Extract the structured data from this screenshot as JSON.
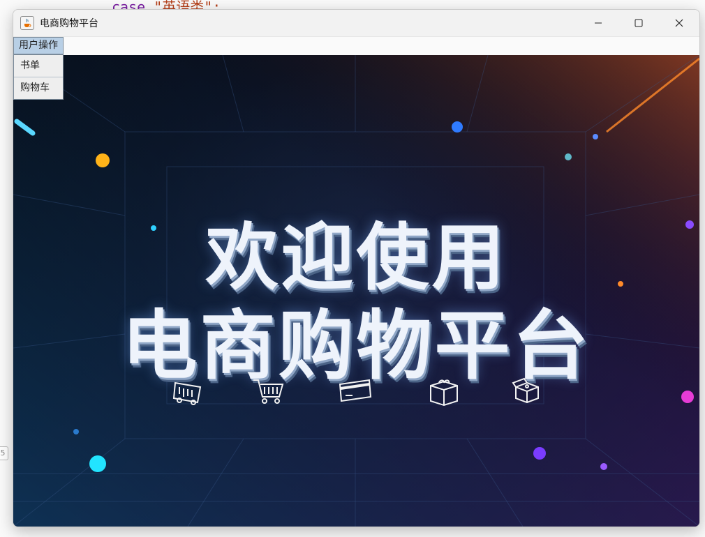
{
  "background": {
    "code_keyword": "case",
    "code_string": "\"英语类\":",
    "gutter_label": "5"
  },
  "window": {
    "title": "电商购物平台",
    "app_icon": "java-cup-icon",
    "controls": [
      "minimize-icon",
      "maximize-icon",
      "close-icon"
    ]
  },
  "menubar": {
    "menu_label": "用户操作",
    "dropdown_items": [
      "书单",
      "购物车"
    ]
  },
  "banner": {
    "line1": "欢迎使用",
    "line2": "电商购物平台",
    "icons": [
      "ticket-icon",
      "shopping-cart-icon",
      "credit-card-icon",
      "package-box-icon",
      "open-box-icon"
    ]
  },
  "colors": {
    "menu_highlight": "#b8cfe5",
    "banner_bg": "#0b0f1e",
    "accent_orange": "#ff8a2a",
    "accent_blue": "#2f7bff",
    "accent_magenta": "#c83cff"
  }
}
